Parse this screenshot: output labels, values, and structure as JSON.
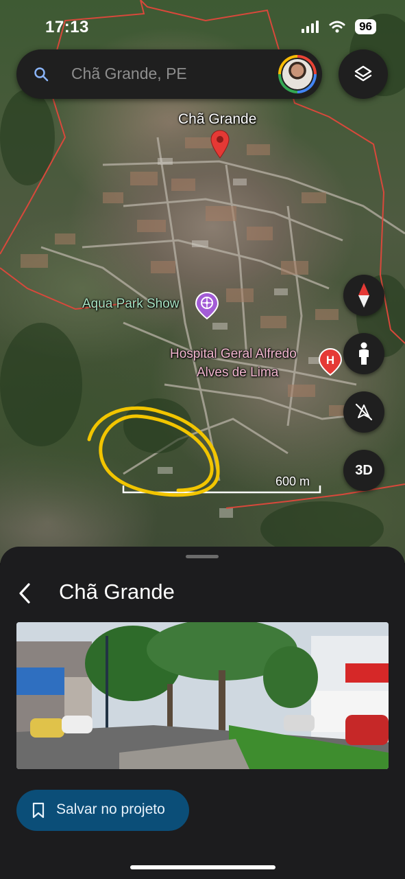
{
  "status_bar": {
    "time": "17:13",
    "battery": "96"
  },
  "search": {
    "value": "Chã Grande, PE"
  },
  "map": {
    "place_label": "Chã Grande",
    "poi_aqua_park": "Aqua Park Show",
    "poi_hospital_line1": "Hospital Geral Alfredo",
    "poi_hospital_line2": "Alves de Lima",
    "hospital_badge": "H",
    "scale_label": "600 m",
    "view_3d_label": "3D"
  },
  "sheet": {
    "title": "Chã Grande",
    "save_button_label": "Salvar no projeto"
  },
  "colors": {
    "sheet_bg": "#1c1c1e",
    "save_button": "#0b4e78",
    "pin": "#e53935",
    "aqua_park_poi": "#a35cd6",
    "hospital_poi": "#e53935",
    "boundary": "#d9483b",
    "annotation_scribble": "#f2c500"
  },
  "icons": [
    "search-icon",
    "layers-icon",
    "compass-icon",
    "pegman-icon",
    "north-off-icon",
    "back-arrow-icon",
    "bookmark-icon",
    "location-pin-icon"
  ]
}
